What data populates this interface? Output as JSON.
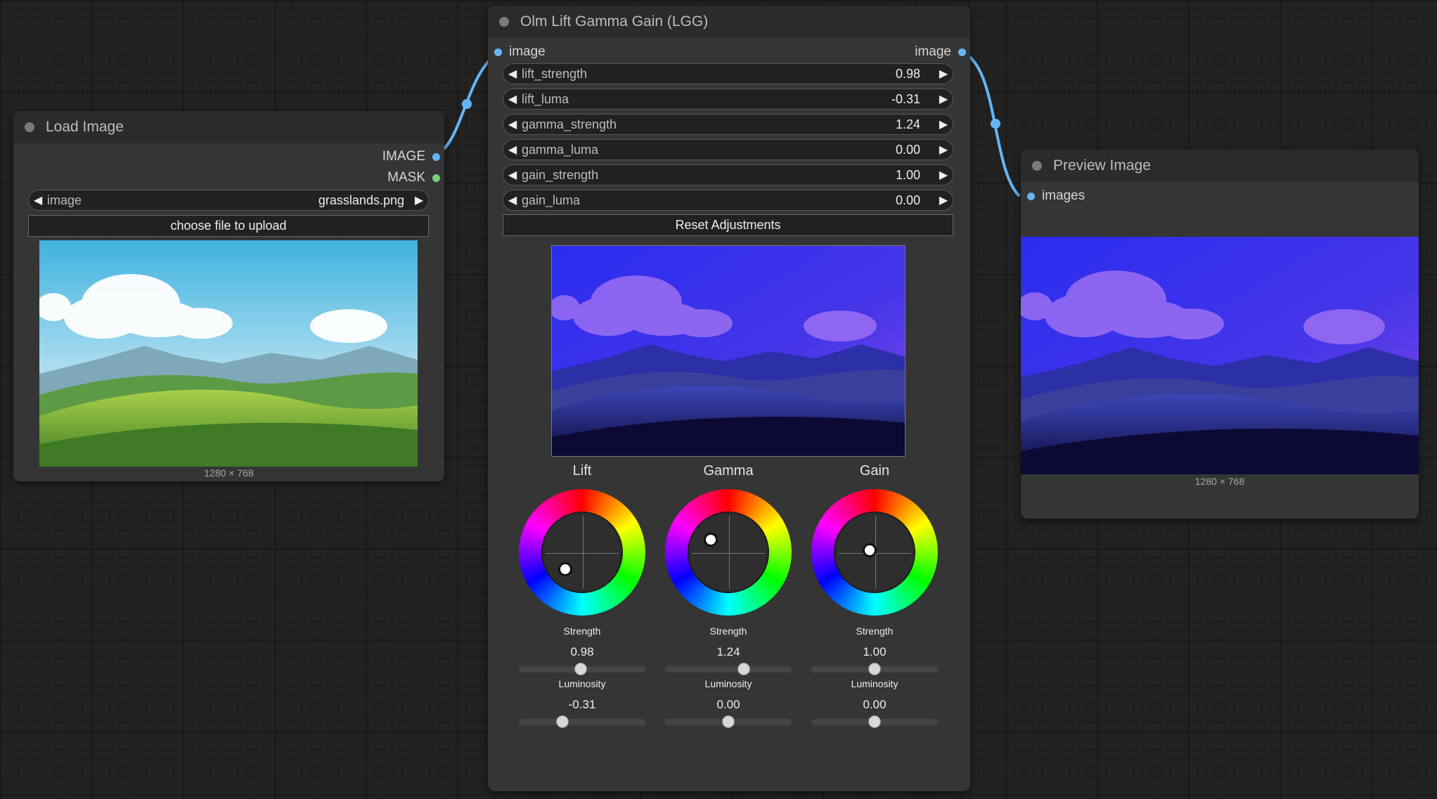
{
  "colors": {
    "wire": "#64b5f6",
    "image_slot": "#64b5f6",
    "mask_slot": "#7bd17b",
    "node_bg": "#353535",
    "canvas_bg": "#222222"
  },
  "load_image": {
    "title": "Load Image",
    "outputs": [
      "IMAGE",
      "MASK"
    ],
    "widget_label": "image",
    "widget_value": "grasslands.png",
    "upload_label": "choose file to upload",
    "dimensions": "1280 × 768"
  },
  "lgg": {
    "title": "Olm Lift Gamma Gain (LGG)",
    "input_label": "image",
    "output_label": "image",
    "widgets": [
      {
        "label": "lift_strength",
        "value": "0.98"
      },
      {
        "label": "lift_luma",
        "value": "-0.31"
      },
      {
        "label": "gamma_strength",
        "value": "1.24"
      },
      {
        "label": "gamma_luma",
        "value": "0.00"
      },
      {
        "label": "gain_strength",
        "value": "1.00"
      },
      {
        "label": "gain_luma",
        "value": "0.00"
      }
    ],
    "reset_label": "Reset Adjustments",
    "wheels": [
      {
        "title": "Lift",
        "strength_label": "Strength",
        "strength_value": "0.98",
        "strength": 0.98,
        "luminosity_label": "Luminosity",
        "luminosity_value": "-0.31",
        "luminosity": -0.31
      },
      {
        "title": "Gamma",
        "strength_label": "Strength",
        "strength_value": "1.24",
        "strength": 1.24,
        "luminosity_label": "Luminosity",
        "luminosity_value": "0.00",
        "luminosity": 0.0
      },
      {
        "title": "Gain",
        "strength_label": "Strength",
        "strength_value": "1.00",
        "strength": 1.0,
        "luminosity_label": "Luminosity",
        "luminosity_value": "0.00",
        "luminosity": 0.0
      }
    ]
  },
  "preview": {
    "title": "Preview Image",
    "input_label": "images",
    "dimensions": "1280 × 768"
  }
}
